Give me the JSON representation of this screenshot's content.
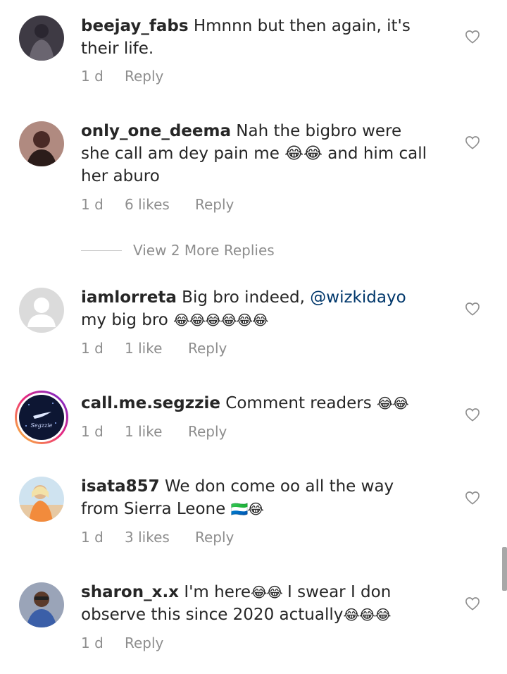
{
  "comments": [
    {
      "username": "beejay_fabs",
      "text": "Hmnnn but then again, it's their life.",
      "emoji": "",
      "time": "1 d",
      "likes": "",
      "reply": "Reply",
      "avatar_color": "#4a4650"
    },
    {
      "username": "only_one_deema",
      "text": "Nah the bigbro were she call am dey pain me 😂😂 and him call her aburo",
      "emoji": "😂😂",
      "time": "1 d",
      "likes": "6 likes",
      "reply": "Reply",
      "avatar_color": "#7a4a4f"
    },
    {
      "username": "iamlorreta",
      "text_before": "Big bro indeed, ",
      "mention": "@wizkidayo",
      "text_after": " my big bro",
      "emoji": "😂😂😂😂😂😂",
      "time": "1 d",
      "likes": "1 like",
      "reply": "Reply",
      "avatar_color": "#dbdbdb"
    },
    {
      "username": "call.me.segzzie",
      "text": "Comment readers",
      "emoji": "😂😂",
      "time": "1 d",
      "likes": "1 like",
      "reply": "Reply",
      "avatar_color": "#0d1633",
      "avatar_caption": "Segzzie"
    },
    {
      "username": "isata857",
      "text": "We don come oo all the way from Sierra Leone",
      "emoji": "🇸🇱😂",
      "time": "1 d",
      "likes": "3 likes",
      "reply": "Reply",
      "avatar_color": "#c9b49a"
    },
    {
      "username": "sharon_x.x",
      "text_before": "I'm here",
      "emoji_mid": "😂😂",
      "text_after": " I swear I don observe this since 2020 actually",
      "emoji": "😂😂😂",
      "time": "1 d",
      "likes": "",
      "reply": "Reply",
      "avatar_color": "#6e7890"
    }
  ],
  "view_more": "View 2 More Replies",
  "colors": {
    "text": "#262626",
    "meta": "#8e8e8e",
    "mention": "#00376b"
  }
}
